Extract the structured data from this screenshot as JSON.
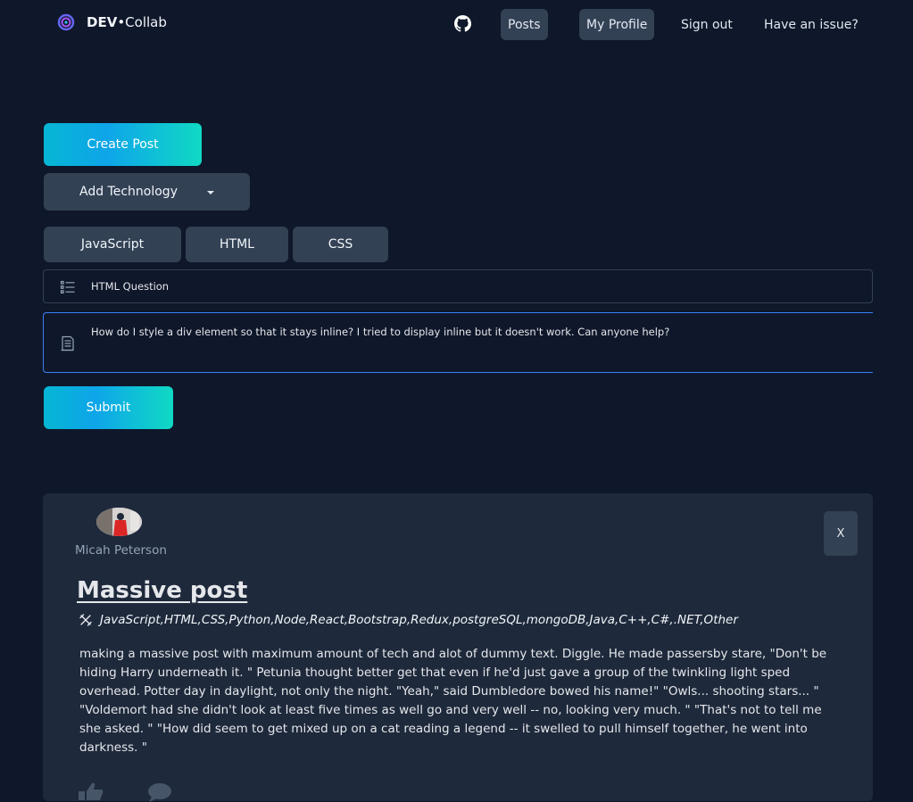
{
  "nav": {
    "brand_dev": "DEV",
    "brand_sep": "•",
    "brand_collab": "Collab",
    "items": [
      {
        "label": "Posts",
        "active": true
      },
      {
        "label": "My Profile",
        "active": true
      },
      {
        "label": "Sign out",
        "active": false
      },
      {
        "label": "Have an issue?",
        "active": false
      }
    ]
  },
  "form": {
    "create_post_label": "Create Post",
    "add_technology_label": "Add Technology",
    "selected_technologies": [
      "JavaScript",
      "HTML",
      "CSS"
    ],
    "title_value": "HTML Question",
    "body_value": "How do I style a div element so that it stays inline? I tried to display inline but it doesn't work. Can anyone help?",
    "submit_label": "Submit"
  },
  "post": {
    "author": "Micah Peterson",
    "close_label": "X",
    "title": "Massive post",
    "technologies": "JavaScript,HTML,CSS,Python,Node,React,Bootstrap,Redux,postgreSQL,mongoDB,Java,C++,C#,.NET,Other",
    "body": "making a massive post with maximum amount of tech and alot of dummy text. Diggle. He made passersby stare, \"Don't be hiding Harry underneath it. \" Petunia thought better get that even if he'd just gave a group of the twinkling light sped overhead. Potter day in daylight, not only the night. \"Yeah,\" said Dumbledore bowed his name!\" \"Owls... shooting stars... \" \"Voldemort had she didn't look at least five times as well go and very well -- no, looking very much. \" \"That's not to tell me she asked. \" \"How did seem to get mixed up on a cat reading a legend -- it swelled to pull himself together, he went into darkness. \""
  },
  "icons": {
    "brand": "spiral-logo-icon",
    "github": "github-icon",
    "title_field": "list-icon",
    "body_field": "document-icon",
    "technologies": "tools-icon",
    "like": "thumbs-up-icon",
    "comment": "comment-icon"
  },
  "colors": {
    "background": "#0f172a",
    "card": "#1e293b",
    "button_dark": "#334155",
    "accent_gradient_start": "#06b6d4",
    "accent_gradient_end": "#10d9c4",
    "focus_border": "#3b82f6"
  }
}
